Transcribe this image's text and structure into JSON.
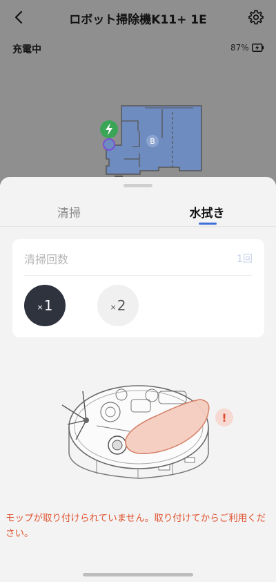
{
  "header": {
    "title": "ロボット掃除機K11+ 1E",
    "back_icon": "chevron-left-icon",
    "settings_icon": "gear-icon"
  },
  "status": {
    "text": "充電中",
    "battery_percent": "87%",
    "battery_icon": "battery-charging-icon"
  },
  "map": {
    "room_label": "B",
    "dock_icon": "lightning-icon"
  },
  "tabs": [
    {
      "label": "清掃",
      "active": false
    },
    {
      "label": "水拭き",
      "active": true
    }
  ],
  "mop_card": {
    "title": "清掃回数",
    "value": "1回",
    "options": [
      {
        "prefix": "×",
        "label": "1",
        "selected": true
      },
      {
        "prefix": "×",
        "label": "2",
        "selected": false
      }
    ]
  },
  "warning": {
    "icon_text": "!",
    "message": "モップが取り付けられていません。取り付けてからご利用ください。"
  },
  "colors": {
    "accent": "#3d6fd8",
    "warning": "#e0522f",
    "selected_option": "#2e333e",
    "map_floor": "#6f8cc0",
    "dock_green": "#3aa556"
  }
}
